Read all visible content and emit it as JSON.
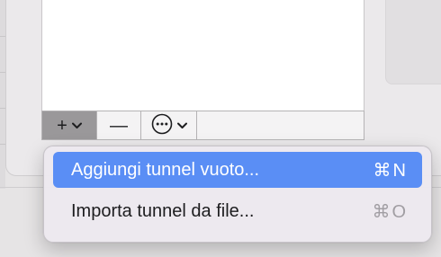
{
  "toolbar": {
    "add_glyph": "+",
    "remove_glyph": "—",
    "more_glyph": "⊙"
  },
  "menu": {
    "items": [
      {
        "label": "Aggiungi tunnel vuoto...",
        "shortcut": "⌘N",
        "highlighted": true
      },
      {
        "label": "Importa tunnel da file...",
        "shortcut": "⌘O",
        "highlighted": false
      }
    ]
  },
  "icons": {
    "add": "plus-icon",
    "remove": "minus-icon",
    "more": "ellipsis-circle-icon",
    "dropdown": "chevron-down-icon"
  },
  "colors": {
    "highlight": "#5a8ef5",
    "active_button": "#9a989a",
    "menu_background": "#ece8ee"
  }
}
